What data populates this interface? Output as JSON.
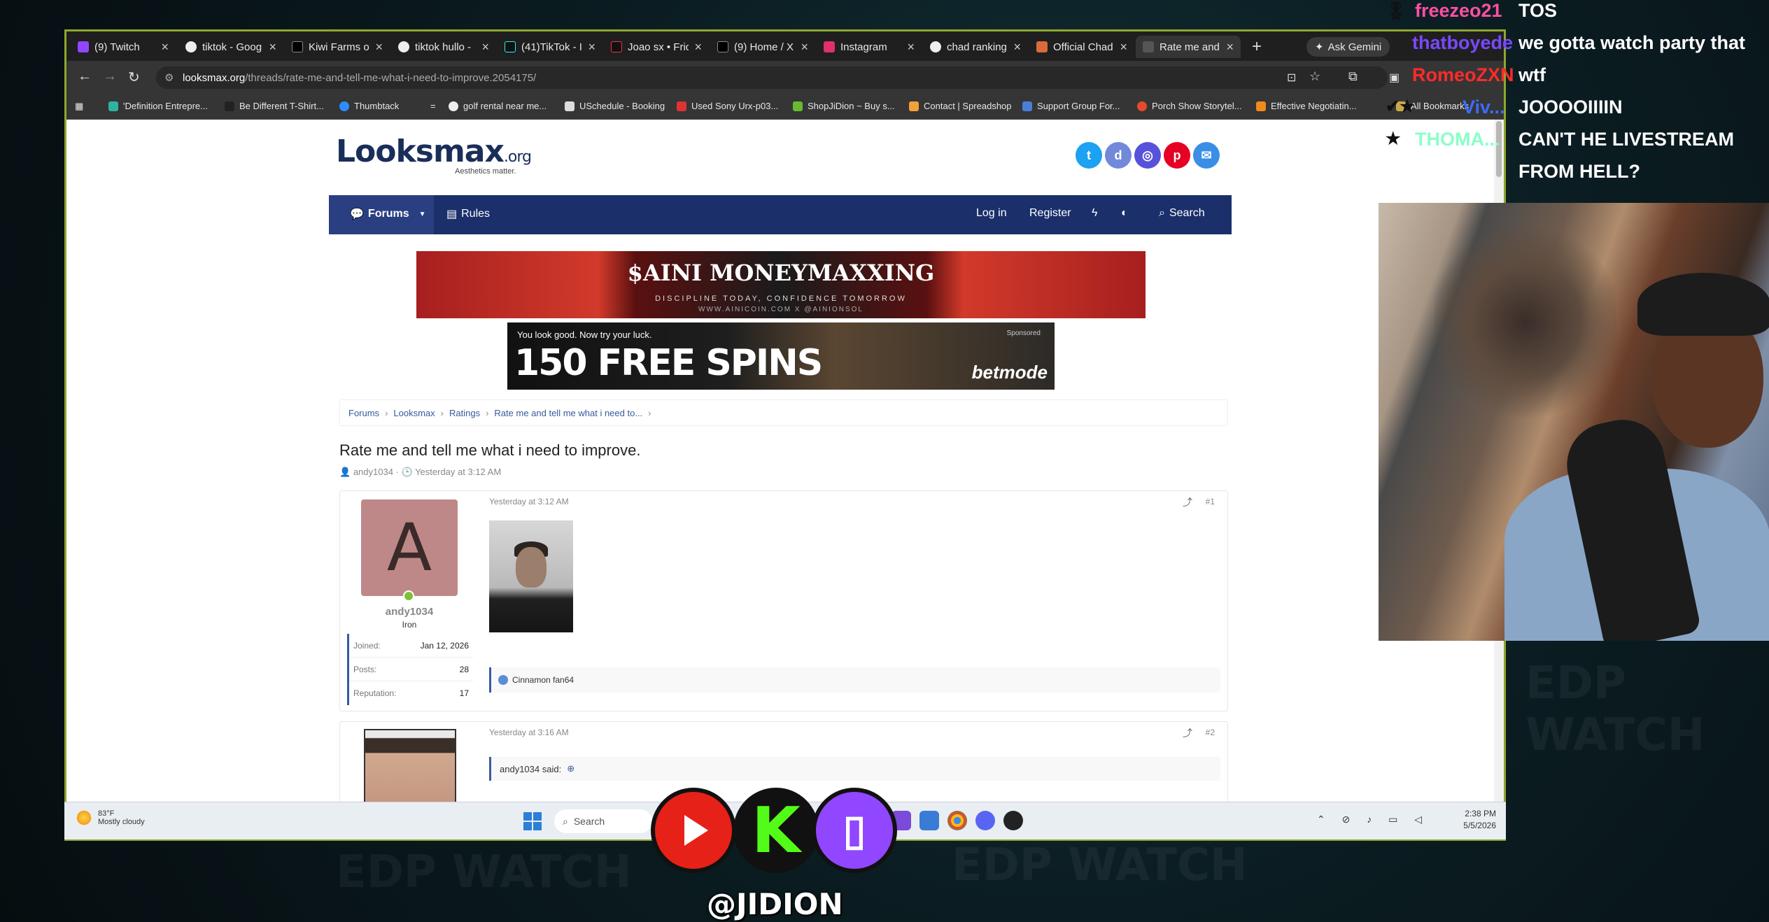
{
  "browser": {
    "tabs": [
      {
        "label": "(9) Twitch",
        "color": "#9146ff"
      },
      {
        "label": "tiktok - Goog",
        "color": "#e8e8e8"
      },
      {
        "label": "Kiwi Farms o",
        "color": "#e8e8e8"
      },
      {
        "label": "tiktok hullo -",
        "color": "#e8e8e8"
      },
      {
        "label": "(41)TikTok - I",
        "color": "#e8e8e8"
      },
      {
        "label": "Joao sx • Fric",
        "color": "#e8e8e8"
      },
      {
        "label": "(9) Home / X",
        "color": "#e8e8e8"
      },
      {
        "label": "Instagram",
        "color": "#e1306c"
      },
      {
        "label": "chad ranking",
        "color": "#e8e8e8"
      },
      {
        "label": "Official Chad",
        "color": "#d86a3c"
      },
      {
        "label": "Rate me and",
        "color": "#e8e8e8"
      }
    ],
    "new_tab": "+",
    "gemini_label": "Ask Gemini",
    "url_domain": "looksmax.org",
    "url_path": "/threads/rate-me-and-tell-me-what-i-need-to-improve.2054175/",
    "bookmarks": [
      "'Definition Entrepre...",
      "Be Different T-Shirt...",
      "Thumbtack",
      "=",
      "golf rental near me...",
      "USchedule - Booking",
      "Used Sony Urx-p03...",
      "ShopJiDion ~ Buy s...",
      "Contact | Spreadshop",
      "Support Group For...",
      "Porch Show Storytel...",
      "Effective Negotiatin...",
      "All Bookmarks"
    ]
  },
  "site": {
    "logo": "Looksmax",
    "logo_suffix": ".org",
    "tagline": "Aesthetics matter.",
    "nav": {
      "forums": "Forums",
      "rules": "Rules",
      "login": "Log in",
      "register": "Register",
      "search": "Search"
    },
    "ad1": {
      "title": "$AINI MONEYMAXXING",
      "line1": "DISCIPLINE TODAY, CONFIDENCE TOMORROW",
      "line2": "WWW.AINICOIN.COM  X @AINIONSOL"
    },
    "ad2": {
      "top": "You look good. Now try your luck.",
      "main": "150 FREE SPINS",
      "sponsored": "Sponsored",
      "brand": "betmode"
    },
    "breadcrumb": [
      "Forums",
      "Looksmax",
      "Ratings",
      "Rate me and tell me what i need to..."
    ],
    "thread_title": "Rate me and tell me what i need to improve.",
    "thread_author": "andy1034",
    "thread_time": "Yesterday at 3:12 AM"
  },
  "post1": {
    "date": "Yesterday at 3:12 AM",
    "num": "#1",
    "avatar_letter": "A",
    "username": "andy1034",
    "rank": "Iron",
    "stats": [
      {
        "label": "Joined:",
        "value": "Jan 12, 2026"
      },
      {
        "label": "Posts:",
        "value": "28"
      },
      {
        "label": "Reputation:",
        "value": "17"
      }
    ],
    "signature": "Cinnamon fan64"
  },
  "post2": {
    "date": "Yesterday at 3:16 AM",
    "num": "#2",
    "quote": "andy1034 said:"
  },
  "taskbar": {
    "temp": "83°F",
    "weather": "Mostly cloudy",
    "search": "Search",
    "time": "2:38 PM",
    "date": "5/5/2026"
  },
  "chat": [
    {
      "user": "freezeo21",
      "user_color": "#ff4fa3",
      "msg": "TOS"
    },
    {
      "user": "thatboyede",
      "user_color": "#7a48ff",
      "msg": "we gotta watch party that"
    },
    {
      "user": "RomeoZXN",
      "user_color": "#ff2a2a",
      "msg": "wtf"
    },
    {
      "user": "Viv...",
      "user_color": "#3a6cff",
      "msg": "JOOOOIIIIN"
    },
    {
      "user": "THOMA...",
      "user_color": "#8affc8",
      "msg": "CAN'T HE LIVESTREAM"
    },
    {
      "user": "",
      "user_color": "#ffffff",
      "msg": "FROM HELL?"
    }
  ],
  "stream": {
    "handle": "@JIDION",
    "watermark": "EDP WATCH"
  }
}
